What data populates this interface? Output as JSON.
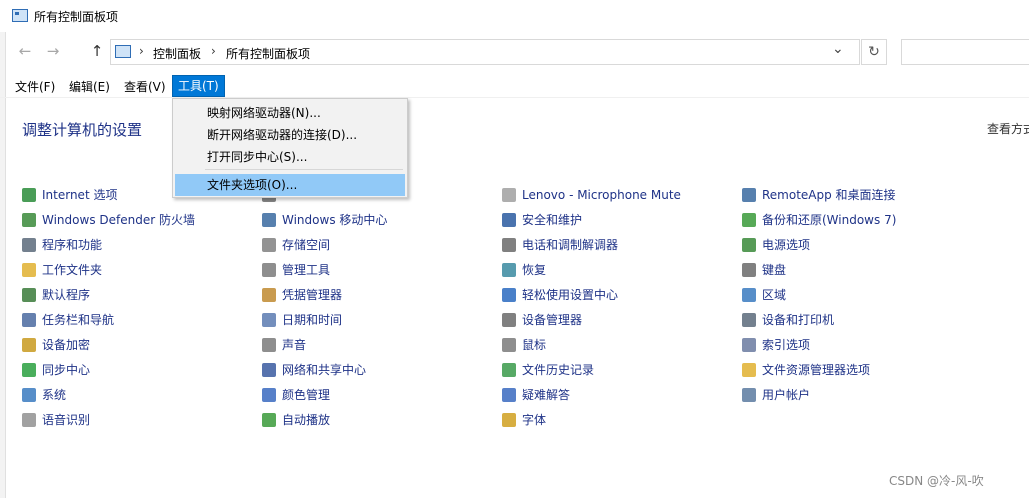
{
  "window": {
    "title": "所有控制面板项"
  },
  "nav": {
    "back_glyph": "←",
    "forward_glyph": "→",
    "up_glyph": "↑",
    "breadcrumb": [
      "控制面板",
      "所有控制面板项"
    ],
    "sep_glyph": "›",
    "dropdown_glyph": "⌄",
    "refresh_glyph": "↻"
  },
  "menubar": [
    "文件(F)",
    "编辑(E)",
    "查看(V)",
    "工具(T)"
  ],
  "tools_menu": {
    "items": [
      "映射网络驱动器(N)...",
      "断开网络驱动器的连接(D)...",
      "打开同步中心(S)...",
      "文件夹选项(O)..."
    ],
    "highlighted_index": 3
  },
  "page": {
    "title": "调整计算机的设置",
    "view_by": "查看方式"
  },
  "columns": [
    [
      {
        "label": "Internet 选项",
        "icon": "globe-icon",
        "color": "#2a8c3a"
      },
      {
        "label": "Windows Defender 防火墙",
        "icon": "firewall-icon",
        "color": "#3a8a3a"
      },
      {
        "label": "程序和功能",
        "icon": "programs-icon",
        "color": "#5a6a7a"
      },
      {
        "label": "工作文件夹",
        "icon": "folder-icon",
        "color": "#e0b030"
      },
      {
        "label": "默认程序",
        "icon": "default-programs-icon",
        "color": "#3a7a3a"
      },
      {
        "label": "任务栏和导航",
        "icon": "taskbar-icon",
        "color": "#4a6aa0"
      },
      {
        "label": "设备加密",
        "icon": "key-icon",
        "color": "#c89a20"
      },
      {
        "label": "同步中心",
        "icon": "sync-icon",
        "color": "#2aa040"
      },
      {
        "label": "系统",
        "icon": "system-icon",
        "color": "#3a7ac0"
      },
      {
        "label": "语音识别",
        "icon": "microphone-icon",
        "color": "#909090"
      }
    ],
    [
      {
        "label": "",
        "icon": "partial-icon",
        "color": "#707070"
      },
      {
        "label": "Windows 移动中心",
        "icon": "mobility-icon",
        "color": "#3a6aa0"
      },
      {
        "label": "存储空间",
        "icon": "storage-icon",
        "color": "#808080"
      },
      {
        "label": "管理工具",
        "icon": "admin-tools-icon",
        "color": "#7a7a7a"
      },
      {
        "label": "凭据管理器",
        "icon": "credentials-icon",
        "color": "#c08a30"
      },
      {
        "label": "日期和时间",
        "icon": "clock-icon",
        "color": "#5a7ab0"
      },
      {
        "label": "声音",
        "icon": "speaker-icon",
        "color": "#7a7a7a"
      },
      {
        "label": "网络和共享中心",
        "icon": "network-icon",
        "color": "#3a5aa0"
      },
      {
        "label": "颜色管理",
        "icon": "color-management-icon",
        "color": "#3a6ac0"
      },
      {
        "label": "自动播放",
        "icon": "autoplay-icon",
        "color": "#3a9a3a"
      }
    ],
    [
      {
        "label": "Lenovo - Microphone Mute",
        "icon": "document-icon",
        "color": "#a0a0a0"
      },
      {
        "label": "安全和维护",
        "icon": "flag-icon",
        "color": "#2a5aa0"
      },
      {
        "label": "电话和调制解调器",
        "icon": "modem-icon",
        "color": "#6a6a6a"
      },
      {
        "label": "恢复",
        "icon": "recovery-icon",
        "color": "#3a8aa0"
      },
      {
        "label": "轻松使用设置中心",
        "icon": "ease-of-access-icon",
        "color": "#2a6ac0"
      },
      {
        "label": "设备管理器",
        "icon": "device-manager-icon",
        "color": "#6a6a6a"
      },
      {
        "label": "鼠标",
        "icon": "mouse-icon",
        "color": "#7a7a7a"
      },
      {
        "label": "文件历史记录",
        "icon": "file-history-icon",
        "color": "#3a9a4a"
      },
      {
        "label": "疑难解答",
        "icon": "troubleshooting-icon",
        "color": "#3a6ac0"
      },
      {
        "label": "字体",
        "icon": "font-icon",
        "color": "#d0a020"
      }
    ],
    [
      {
        "label": "RemoteApp 和桌面连接",
        "icon": "remoteapp-icon",
        "color": "#3a6aa0"
      },
      {
        "label": "备份和还原(Windows 7)",
        "icon": "backup-icon",
        "color": "#3a9a3a"
      },
      {
        "label": "电源选项",
        "icon": "power-icon",
        "color": "#3a8a3a"
      },
      {
        "label": "键盘",
        "icon": "keyboard-icon",
        "color": "#6a6a6a"
      },
      {
        "label": "区域",
        "icon": "region-icon",
        "color": "#3a7ac0"
      },
      {
        "label": "设备和打印机",
        "icon": "printer-icon",
        "color": "#5a6a7a"
      },
      {
        "label": "索引选项",
        "icon": "indexing-icon",
        "color": "#6a7aa0"
      },
      {
        "label": "文件资源管理器选项",
        "icon": "explorer-options-icon",
        "color": "#e0b030"
      },
      {
        "label": "用户帐户",
        "icon": "user-accounts-icon",
        "color": "#5a7aa0"
      }
    ]
  ],
  "watermark": "CSDN @冷-风-吹"
}
